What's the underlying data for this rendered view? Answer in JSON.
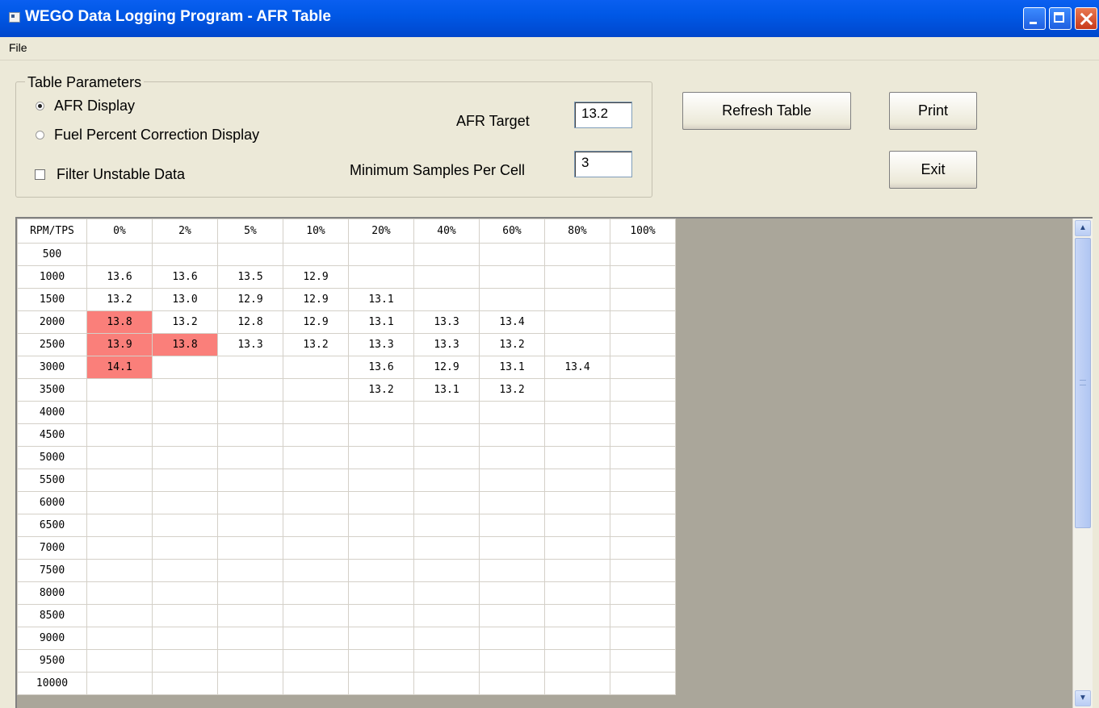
{
  "window": {
    "title": "WEGO Data Logging Program - AFR Table",
    "icon": "app-icon",
    "controls": [
      "minimize-icon",
      "maximize-icon",
      "close-icon"
    ]
  },
  "menu": {
    "file": "File"
  },
  "params": {
    "legend": "Table Parameters",
    "afr_display": "AFR Display",
    "fuel_display": "Fuel Percent Correction Display",
    "filter_label": "Filter Unstable Data",
    "afr_target_label": "AFR Target",
    "afr_target_value": "13.2",
    "min_samples_label": "Minimum Samples Per Cell",
    "min_samples_value": "3",
    "selected": "afr_display",
    "filter_checked": false
  },
  "buttons": {
    "refresh": "Refresh Table",
    "print": "Print",
    "exit": "Exit"
  },
  "table": {
    "corner": "RPM/TPS",
    "columns": [
      "0%",
      "2%",
      "5%",
      "10%",
      "20%",
      "40%",
      "60%",
      "80%",
      "100%"
    ],
    "highlight_color": "#fa7f7a",
    "rows": [
      {
        "rpm": "500",
        "cells": [
          "",
          "",
          "",
          "",
          "",
          "",
          "",
          "",
          ""
        ]
      },
      {
        "rpm": "1000",
        "cells": [
          "13.6",
          "13.6",
          "13.5",
          "12.9",
          "",
          "",
          "",
          "",
          ""
        ]
      },
      {
        "rpm": "1500",
        "cells": [
          "13.2",
          "13.0",
          "12.9",
          "12.9",
          "13.1",
          "",
          "",
          "",
          ""
        ]
      },
      {
        "rpm": "2000",
        "cells": [
          "13.8",
          "13.2",
          "12.8",
          "12.9",
          "13.1",
          "13.3",
          "13.4",
          "",
          ""
        ],
        "hi": [
          0
        ]
      },
      {
        "rpm": "2500",
        "cells": [
          "13.9",
          "13.8",
          "13.3",
          "13.2",
          "13.3",
          "13.3",
          "13.2",
          "",
          ""
        ],
        "hi": [
          0,
          1
        ]
      },
      {
        "rpm": "3000",
        "cells": [
          "14.1",
          "",
          "",
          "",
          "13.6",
          "12.9",
          "13.1",
          "13.4",
          ""
        ],
        "hi": [
          0
        ]
      },
      {
        "rpm": "3500",
        "cells": [
          "",
          "",
          "",
          "",
          "13.2",
          "13.1",
          "13.2",
          "",
          ""
        ]
      },
      {
        "rpm": "4000",
        "cells": [
          "",
          "",
          "",
          "",
          "",
          "",
          "",
          "",
          ""
        ]
      },
      {
        "rpm": "4500",
        "cells": [
          "",
          "",
          "",
          "",
          "",
          "",
          "",
          "",
          ""
        ]
      },
      {
        "rpm": "5000",
        "cells": [
          "",
          "",
          "",
          "",
          "",
          "",
          "",
          "",
          ""
        ]
      },
      {
        "rpm": "5500",
        "cells": [
          "",
          "",
          "",
          "",
          "",
          "",
          "",
          "",
          ""
        ]
      },
      {
        "rpm": "6000",
        "cells": [
          "",
          "",
          "",
          "",
          "",
          "",
          "",
          "",
          ""
        ]
      },
      {
        "rpm": "6500",
        "cells": [
          "",
          "",
          "",
          "",
          "",
          "",
          "",
          "",
          ""
        ]
      },
      {
        "rpm": "7000",
        "cells": [
          "",
          "",
          "",
          "",
          "",
          "",
          "",
          "",
          ""
        ]
      },
      {
        "rpm": "7500",
        "cells": [
          "",
          "",
          "",
          "",
          "",
          "",
          "",
          "",
          ""
        ]
      },
      {
        "rpm": "8000",
        "cells": [
          "",
          "",
          "",
          "",
          "",
          "",
          "",
          "",
          ""
        ]
      },
      {
        "rpm": "8500",
        "cells": [
          "",
          "",
          "",
          "",
          "",
          "",
          "",
          "",
          ""
        ]
      },
      {
        "rpm": "9000",
        "cells": [
          "",
          "",
          "",
          "",
          "",
          "",
          "",
          "",
          ""
        ]
      },
      {
        "rpm": "9500",
        "cells": [
          "",
          "",
          "",
          "",
          "",
          "",
          "",
          "",
          ""
        ]
      },
      {
        "rpm": "10000",
        "cells": [
          "",
          "",
          "",
          "",
          "",
          "",
          "",
          "",
          ""
        ]
      }
    ]
  }
}
